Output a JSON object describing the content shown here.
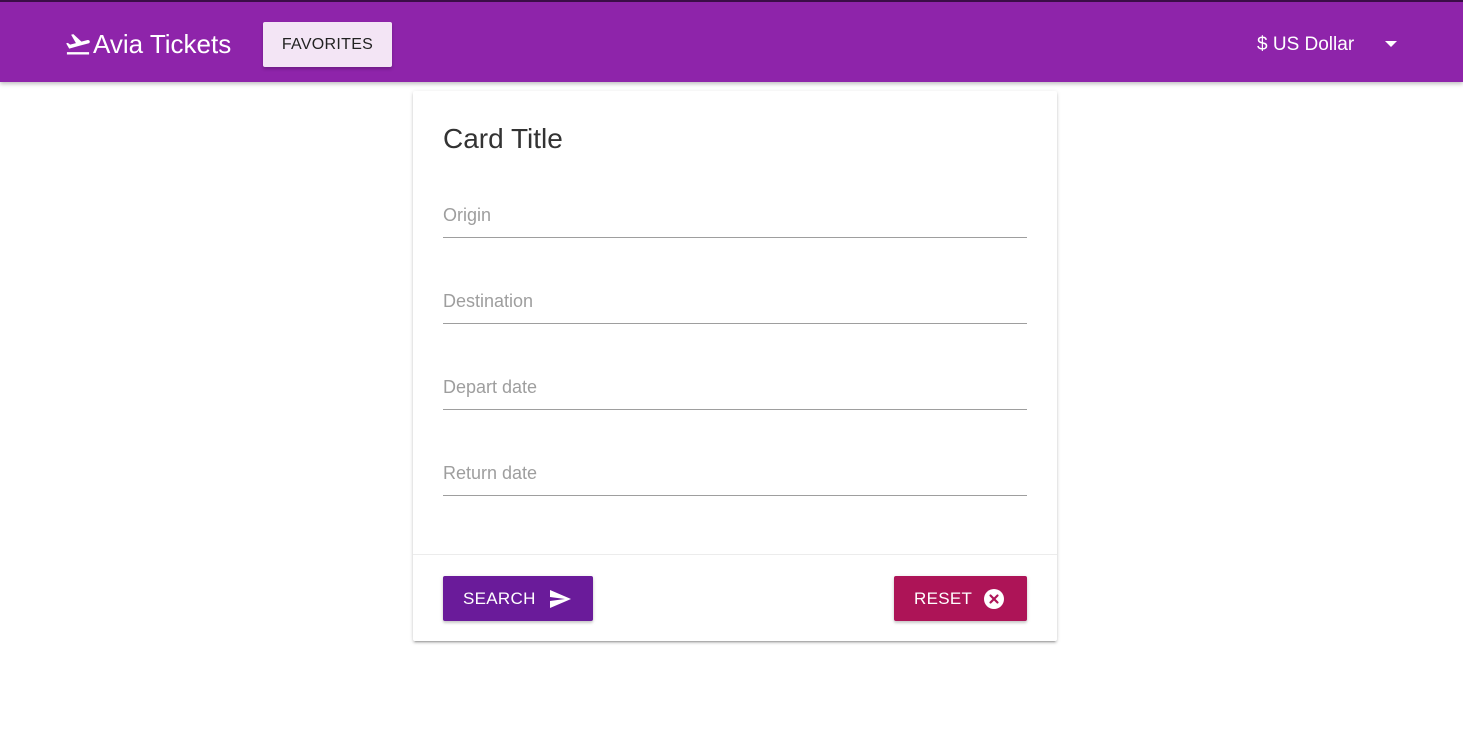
{
  "navbar": {
    "brand_icon": "flight-takeoff-icon",
    "brand_title": "Avia Tickets",
    "favorites_label": "FAVORITES",
    "currency_label": "$ US Dollar",
    "currency_icon": "caret-down-icon",
    "background_color": "#8e24aa"
  },
  "card": {
    "title": "Card Title",
    "fields": {
      "origin": {
        "placeholder": "Origin",
        "value": ""
      },
      "destination": {
        "placeholder": "Destination",
        "value": ""
      },
      "depart_date": {
        "placeholder": "Depart date",
        "value": ""
      },
      "return_date": {
        "placeholder": "Return date",
        "value": ""
      }
    },
    "actions": {
      "search_label": "SEARCH",
      "search_icon": "send-icon",
      "search_color": "#6a1b9a",
      "reset_label": "RESET",
      "reset_icon": "cancel-circle-icon",
      "reset_color": "#ad1457"
    }
  }
}
